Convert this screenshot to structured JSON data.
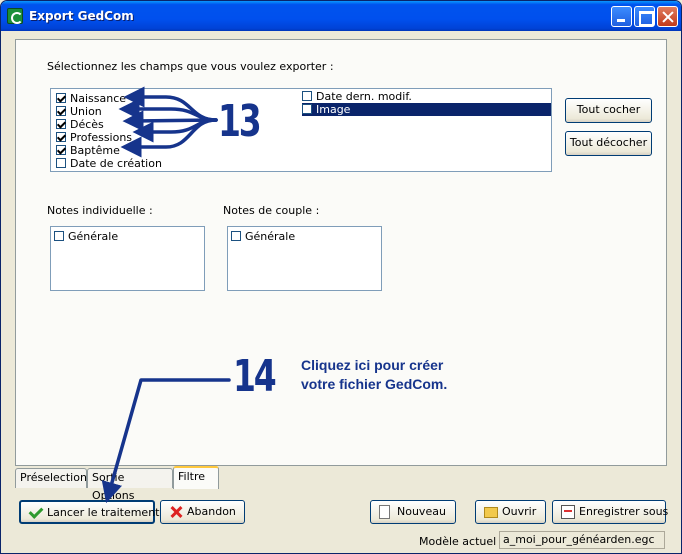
{
  "window": {
    "title": "Export GedCom"
  },
  "panel": {
    "instruction": "Sélectionnez les champs que vous voulez exporter :",
    "fields_left": [
      {
        "label": "Naissance",
        "checked": true
      },
      {
        "label": "Union",
        "checked": true
      },
      {
        "label": "Décès",
        "checked": true
      },
      {
        "label": "Professions",
        "checked": true
      },
      {
        "label": "Baptême",
        "checked": true
      },
      {
        "label": "Date de création",
        "checked": false
      }
    ],
    "fields_right": [
      {
        "label": "Date dern. modif.",
        "checked": false
      },
      {
        "label": "Image",
        "checked": false,
        "selected": true
      }
    ],
    "select_all_label": "Tout cocher",
    "deselect_all_label": "Tout décocher",
    "notes_individual_label": "Notes individuelle :",
    "notes_couple_label": "Notes de couple :",
    "notes_individual_item": "Générale",
    "notes_couple_item": "Générale"
  },
  "annotations": {
    "number_13": "13",
    "number_14": "14",
    "note_line1": "Cliquez ici pour créer",
    "note_line2": "votre fichier GedCom.",
    "color": "#16348c"
  },
  "tabs": [
    {
      "label": "Préselection"
    },
    {
      "label": "Sortie Options"
    },
    {
      "label": "Filtre",
      "active": true
    }
  ],
  "buttons": {
    "run": "Lancer le traitement",
    "abort": "Abandon",
    "new": "Nouveau",
    "open": "Ouvrir",
    "save": "Enregistrer sous"
  },
  "footer": {
    "model_label": "Modèle actuel :",
    "model_value": "a_moi_pour_généarden.egc"
  }
}
